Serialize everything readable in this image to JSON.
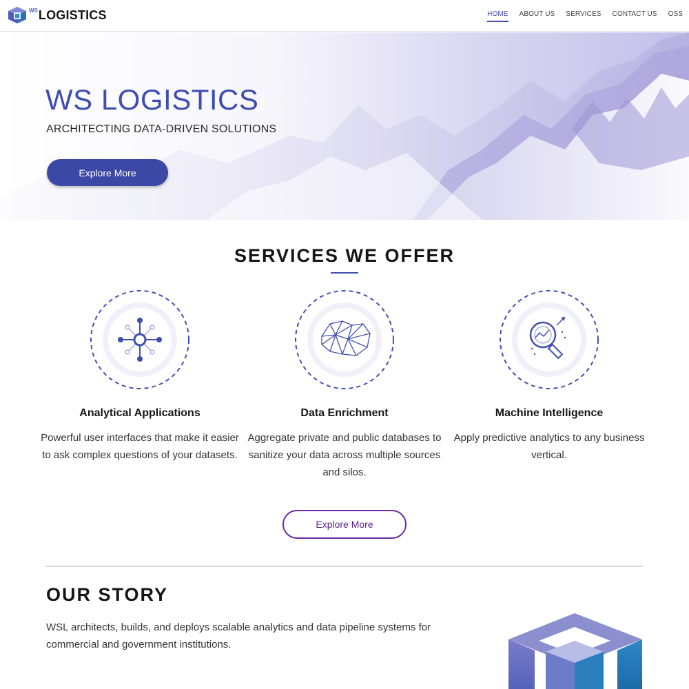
{
  "header": {
    "logo_ws": "WS",
    "logo_text": "LOGISTICS",
    "nav": [
      {
        "label": "HOME",
        "active": true
      },
      {
        "label": "ABOUT US",
        "active": false
      },
      {
        "label": "SERVICES",
        "active": false
      },
      {
        "label": "CONTACT US",
        "active": false
      },
      {
        "label": "OSS",
        "active": false
      }
    ]
  },
  "hero": {
    "title": "WS LOGISTICS",
    "subtitle": "ARCHITECTING DATA-DRIVEN SOLUTIONS",
    "button_label": "Explore More"
  },
  "services": {
    "title": "SERVICES WE OFFER",
    "items": [
      {
        "icon": "network-icon",
        "name": "Analytical Applications",
        "description": "Powerful user interfaces that make it easier to ask complex questions of your datasets."
      },
      {
        "icon": "mesh-polygon-icon",
        "name": "Data Enrichment",
        "description": "Aggregate private and public databases to sanitize your data across multiple sources and silos."
      },
      {
        "icon": "magnifier-analytics-icon",
        "name": "Machine Intelligence",
        "description": "Apply predictive analytics to any business vertical."
      }
    ],
    "button_label": "Explore More"
  },
  "story": {
    "title": "OUR STORY",
    "text": "WSL architects, builds, and deploys scalable analytics and data pipeline systems for commercial and government institutions."
  },
  "colors": {
    "accent": "#3f4fb0",
    "button_outline": "#6d2aa6",
    "hero_tint": "#c3bfea"
  }
}
